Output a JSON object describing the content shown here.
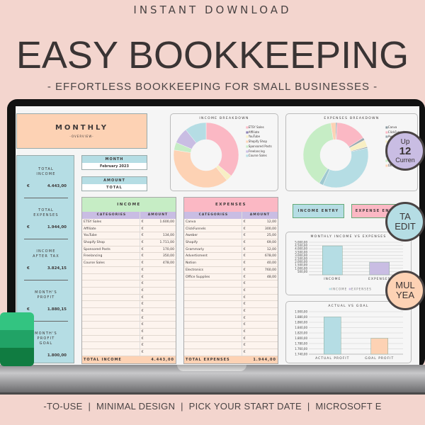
{
  "header": {
    "top": "INSTANT DOWNLOAD",
    "title": "EASY BOOKKEEPING",
    "subtitle": "- EFFORTLESS BOOKKEEPING FOR SMALL BUSINESSES -"
  },
  "footer": "-TO-USE  |  MINIMAL DESIGN  |  PICK YOUR START DATE  |  MICROSOFT E",
  "colors": {
    "background": "#f3d5ce",
    "peach": "#fdd2b4",
    "blue": "#b5dde4",
    "green": "#c6edc5",
    "pink": "#fbb8c4",
    "lavender": "#c9bde3",
    "yellow": "#f8efc4"
  },
  "sheet": {
    "monthly": {
      "title": "MONTHLY",
      "subtitle": "-OVERVIEW-"
    },
    "month": {
      "label": "MONTH",
      "value": "February 2023"
    },
    "amount": {
      "label": "AMOUNT",
      "value": "TOTAL"
    },
    "stats": [
      {
        "label": "TOTAL INCOME",
        "currency": "€",
        "value": "4.443,00"
      },
      {
        "label": "TOTAL EXPENSES",
        "currency": "€",
        "value": "1.944,00"
      },
      {
        "label": "INCOME AFTER TAX",
        "currency": "€",
        "value": "3.824,15"
      },
      {
        "label": "MONTH'S PROFIT",
        "currency": "€",
        "value": "1.880,15"
      },
      {
        "label": "MONTH'S PROFIT GOAL",
        "currency": "€",
        "value": "1.800,00"
      }
    ],
    "income": {
      "title": "INCOME",
      "col1": "CATEGORIES",
      "col2": "AMOUNT",
      "currency": "€",
      "total_label": "TOTAL INCOME",
      "total": "4.443,00",
      "rows": [
        [
          "ETSY Sales",
          "1.600,00"
        ],
        [
          "Affiliate",
          ""
        ],
        [
          "YouTube",
          "134,00"
        ],
        [
          "Shopify Shop",
          "1.711,00"
        ],
        [
          "Sponsored Posts",
          "170,00"
        ],
        [
          "Freelancing",
          "350,00"
        ],
        [
          "Course Sales",
          "478,00"
        ]
      ]
    },
    "expenses": {
      "title": "EXPENSES",
      "col1": "CATEGORIES",
      "col2": "AMOUNT",
      "currency": "€",
      "total_label": "TOTAL EXPENSES",
      "total": "1.944,00",
      "rows": [
        [
          "Canva",
          "12,00"
        ],
        [
          "ClickFunnels",
          "300,00"
        ],
        [
          "Aweber",
          "25,00"
        ],
        [
          "Shopify",
          "69,00"
        ],
        [
          "Grammarly",
          "12,00"
        ],
        [
          "Advertisment",
          "678,00"
        ],
        [
          "Notion",
          "40,00"
        ],
        [
          "Electronics",
          "760,00"
        ],
        [
          "Office Supplies",
          "48,00"
        ]
      ]
    },
    "buttons": {
      "income_entry": "INCOME ENTRY",
      "expense_entry": "EXPENSE ENTRY"
    }
  },
  "chart_data": [
    {
      "type": "pie",
      "title": "INCOME BREAKDOWN",
      "categories": [
        "ETSY Sales",
        "Affiliate",
        "YouTube",
        "Shopify Shop",
        "Sponsored Posts",
        "Freelancing",
        "Course Sales"
      ],
      "values": [
        1600,
        0,
        134,
        1711,
        170,
        350,
        478
      ],
      "colors": [
        "#fbb8c4",
        "#8a7fb5",
        "#f8efc4",
        "#fdd2b4",
        "#c6edc5",
        "#c9bde3",
        "#b5dde4"
      ],
      "legend": "right"
    },
    {
      "type": "pie",
      "title": "EXPENSES BREAKDOWN",
      "categories": [
        "Canva",
        "ClickFunnels",
        "Aweber",
        "Shopify",
        "Grammarly",
        "Advertisment",
        "Notion",
        "Electronics",
        "Office Supplies"
      ],
      "values": [
        12,
        300,
        25,
        69,
        12,
        678,
        40,
        760,
        48
      ],
      "colors": [
        "#8a9aa0",
        "#fbb8c4",
        "#9aa8b0",
        "#f8efc4",
        "#9aa8b0",
        "#b5dde4",
        "#9ec8d0",
        "#c6edc5",
        "#fdd2b4"
      ],
      "legend": "right"
    },
    {
      "type": "bar",
      "title": "MONTHLY INCOME VS EXPENSES",
      "categories": [
        "INCOME",
        "EXPENSES"
      ],
      "values": [
        4443,
        1944
      ],
      "colors": [
        "#b5dde4",
        "#c9bde3"
      ],
      "ylim": [
        0,
        5000
      ],
      "yticks": [
        "500,00",
        "1.000,00",
        "1.500,00",
        "2.000,00",
        "2.500,00",
        "3.000,00",
        "3.500,00",
        "4.000,00",
        "4.500,00",
        "5.000,00"
      ],
      "legend": [
        "INCOME",
        "EXPENSES"
      ],
      "grid": true
    },
    {
      "type": "bar",
      "title": "ACTUAL VS GOAL",
      "categories": [
        "ACTUAL PROFIT",
        "GOAL PROFIT"
      ],
      "values": [
        1880.15,
        1800
      ],
      "colors": [
        "#b5dde4",
        "#fdd2b4"
      ],
      "ylim": [
        1740,
        1900
      ],
      "yticks": [
        "1.740,00",
        "1.760,00",
        "1.780,00",
        "1.800,00",
        "1.820,00",
        "1.840,00",
        "1.860,00",
        "1.880,00",
        "1.900,00"
      ],
      "grid": true
    }
  ],
  "badges": [
    {
      "l1": "Up",
      "l2": "12",
      "l3": "Curren"
    },
    {
      "l1": "TA",
      "l2": "EDIT"
    },
    {
      "l1": "MUL",
      "l2": "YEA"
    }
  ]
}
